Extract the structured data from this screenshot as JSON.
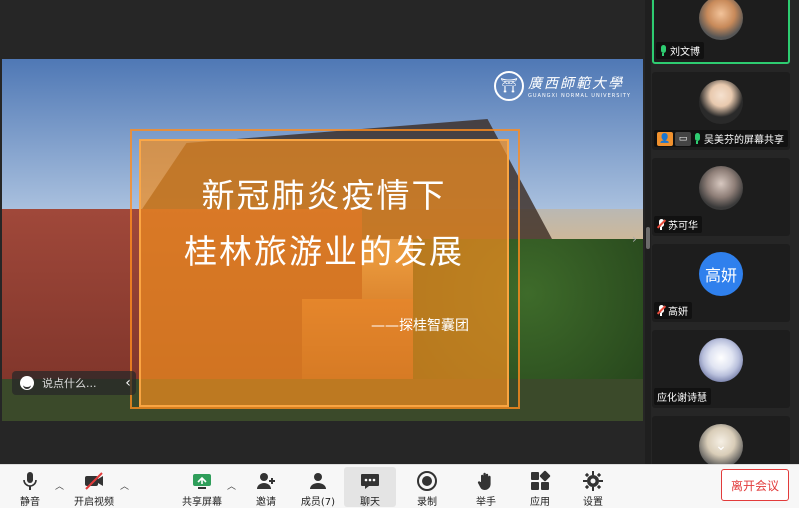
{
  "slide": {
    "title_line1": "新冠肺炎疫情下",
    "title_line2": "桂林旅游业的发展",
    "team": "——探桂智囊团",
    "logo_cn": "廣西師範大學",
    "logo_en": "GUANGXI NORMAL UNIVERSITY"
  },
  "chat": {
    "placeholder": "说点什么..."
  },
  "participants": [
    {
      "name": "刘文博",
      "active": true,
      "muted": false
    },
    {
      "name": "吴美芬的屏幕共享",
      "active": false,
      "muted": false,
      "sharing": true
    },
    {
      "name": "苏可华",
      "active": false,
      "muted": true
    },
    {
      "name": "高妍",
      "active": false,
      "muted": true,
      "initial": "高妍"
    },
    {
      "name": "应化谢诗慧",
      "active": false,
      "muted": false,
      "no_mic_icon": true
    },
    {
      "name": "",
      "active": false,
      "muted": false
    }
  ],
  "toolbar": {
    "mute": "静音",
    "video": "开启视频",
    "share": "共享屏幕",
    "invite": "邀请",
    "members": "成员(7)",
    "chat": "聊天",
    "record": "录制",
    "raise_hand": "举手",
    "apps": "应用",
    "settings": "设置",
    "leave": "离开会议"
  },
  "colors": {
    "accent_green": "#2ecc71",
    "overlay_orange": "#f08c1e",
    "leave_red": "#e23b3b",
    "avatar_blue": "#2f80ed"
  }
}
